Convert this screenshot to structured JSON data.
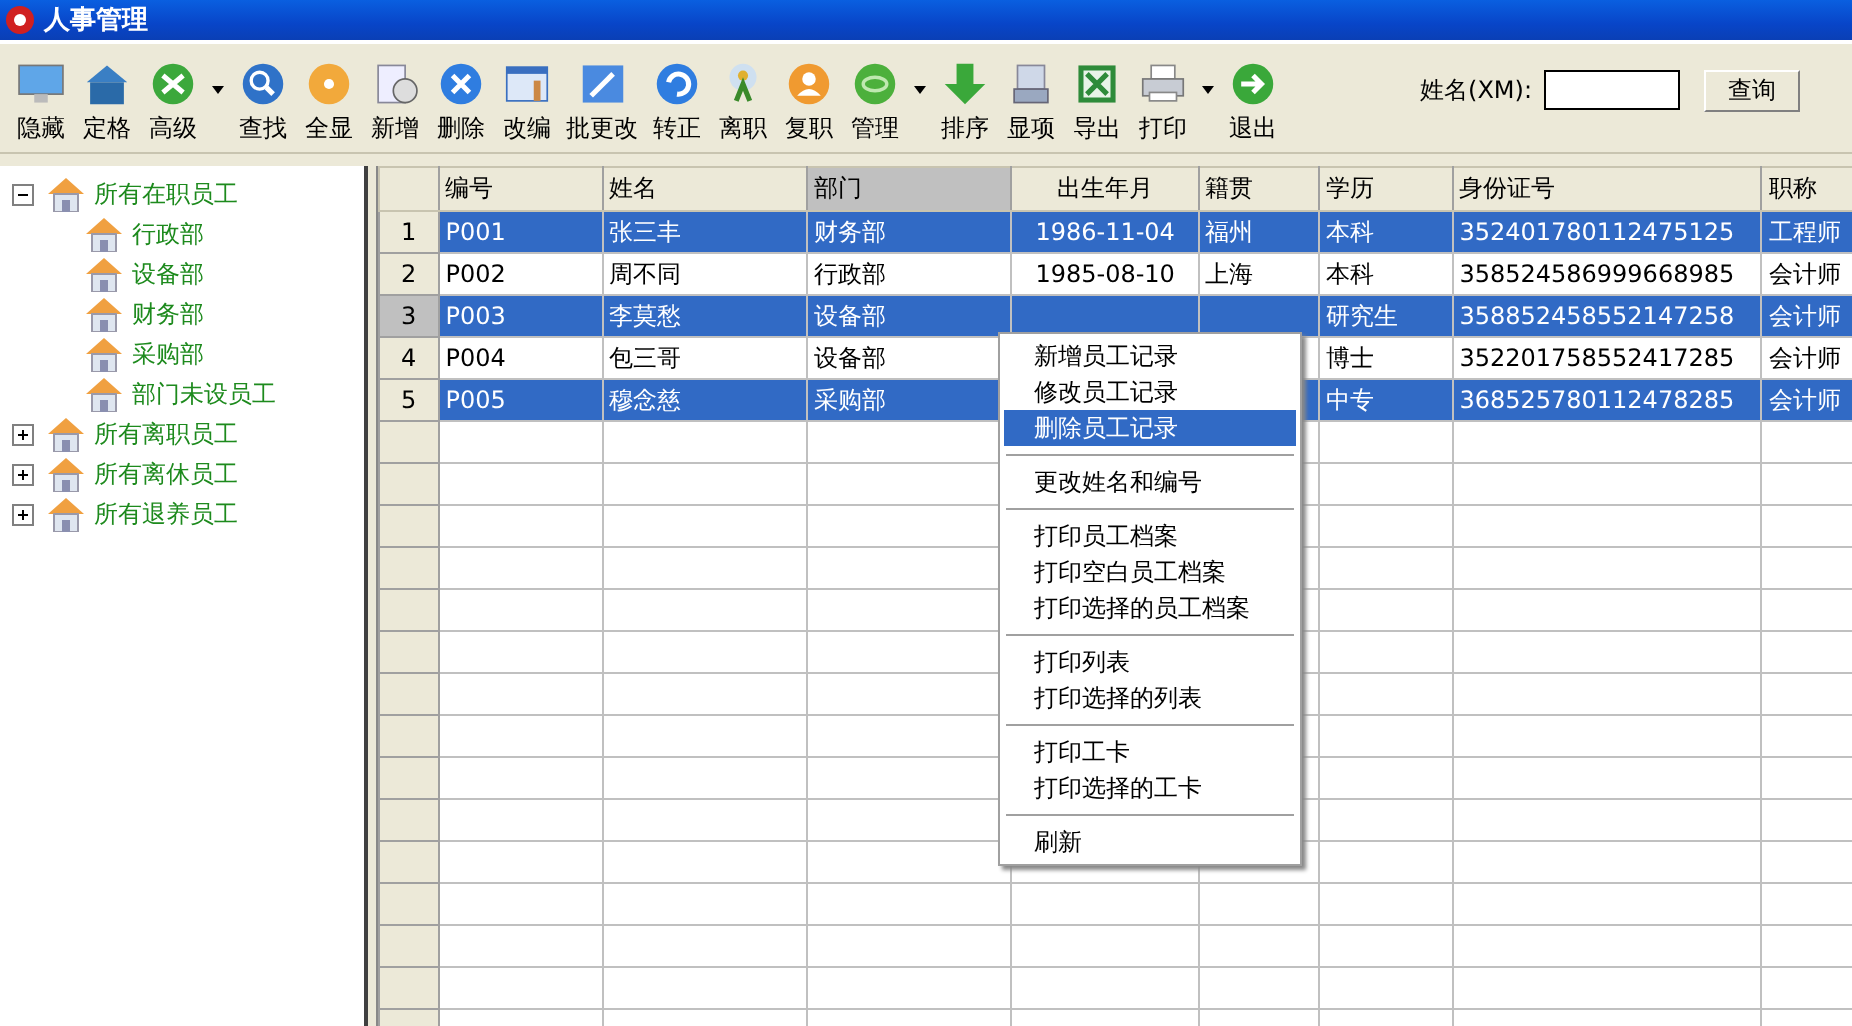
{
  "window": {
    "title": "人事管理"
  },
  "toolbar": {
    "buttons": [
      {
        "label": "隐藏",
        "dropdown": false
      },
      {
        "label": "定格",
        "dropdown": false
      },
      {
        "label": "高级",
        "dropdown": true
      },
      {
        "label": "查找",
        "dropdown": false
      },
      {
        "label": "全显",
        "dropdown": false
      },
      {
        "label": "新增",
        "dropdown": false
      },
      {
        "label": "删除",
        "dropdown": false
      },
      {
        "label": "改编",
        "dropdown": false
      },
      {
        "label": "批更改",
        "dropdown": false
      },
      {
        "label": "转正",
        "dropdown": false
      },
      {
        "label": "离职",
        "dropdown": false
      },
      {
        "label": "复职",
        "dropdown": false
      },
      {
        "label": "管理",
        "dropdown": true
      },
      {
        "label": "排序",
        "dropdown": false
      },
      {
        "label": "显项",
        "dropdown": false
      },
      {
        "label": "导出",
        "dropdown": false
      },
      {
        "label": "打印",
        "dropdown": true
      },
      {
        "label": "退出",
        "dropdown": false
      }
    ],
    "search": {
      "label": "姓名(XM):",
      "button": "查询"
    }
  },
  "tree": [
    {
      "label": "所有在职员工",
      "expanded": true,
      "children": [
        {
          "label": "行政部"
        },
        {
          "label": "设备部"
        },
        {
          "label": "财务部"
        },
        {
          "label": "采购部"
        },
        {
          "label": "部门未设员工"
        }
      ]
    },
    {
      "label": "所有离职员工",
      "expanded": false
    },
    {
      "label": "所有离休员工",
      "expanded": false
    },
    {
      "label": "所有退养员工",
      "expanded": false
    }
  ],
  "table": {
    "columns": [
      {
        "label": "编号",
        "selected": false
      },
      {
        "label": "姓名",
        "selected": false
      },
      {
        "label": "部门",
        "selected": true
      },
      {
        "label": "出生年月",
        "selected": false
      },
      {
        "label": "籍贯",
        "selected": false
      },
      {
        "label": "学历",
        "selected": false
      },
      {
        "label": "身份证号",
        "selected": false
      },
      {
        "label": "职称",
        "selected": false
      }
    ],
    "rows": [
      {
        "number": "1",
        "selected": true,
        "current": false,
        "cells": [
          "P001",
          "张三丰",
          "财务部",
          "1986-11-04",
          "福州",
          "本科",
          "352401780112475125",
          "工程师"
        ]
      },
      {
        "number": "2",
        "selected": false,
        "current": false,
        "cells": [
          "P002",
          "周不同",
          "行政部",
          "1985-08-10",
          "上海",
          "本科",
          "358524586999668985",
          "会计师"
        ]
      },
      {
        "number": "3",
        "selected": true,
        "current": true,
        "cells": [
          "P003",
          "李莫愁",
          "设备部",
          "",
          "",
          "研究生",
          "358852458552147258",
          "会计师"
        ]
      },
      {
        "number": "4",
        "selected": false,
        "current": false,
        "cells": [
          "P004",
          "包三哥",
          "设备部",
          "",
          "",
          "博士",
          "352201758552417285",
          "会计师"
        ]
      },
      {
        "number": "5",
        "selected": true,
        "current": false,
        "cells": [
          "P005",
          "穆念慈",
          "采购部",
          "",
          "",
          "中专",
          "368525780112478285",
          "会计师"
        ]
      }
    ]
  },
  "context_menu": [
    {
      "kind": "item",
      "label": "新增员工记录",
      "selected": false
    },
    {
      "kind": "item",
      "label": "修改员工记录",
      "selected": false
    },
    {
      "kind": "item",
      "label": "删除员工记录",
      "selected": true
    },
    {
      "kind": "separator"
    },
    {
      "kind": "item",
      "label": "更改姓名和编号",
      "selected": false
    },
    {
      "kind": "separator"
    },
    {
      "kind": "item",
      "label": "打印员工档案",
      "selected": false
    },
    {
      "kind": "item",
      "label": "打印空白员工档案",
      "selected": false
    },
    {
      "kind": "item",
      "label": "打印选择的员工档案",
      "selected": false
    },
    {
      "kind": "separator"
    },
    {
      "kind": "item",
      "label": "打印列表",
      "selected": false
    },
    {
      "kind": "item",
      "label": "打印选择的列表",
      "selected": false
    },
    {
      "kind": "separator"
    },
    {
      "kind": "item",
      "label": "打印工卡",
      "selected": false
    },
    {
      "kind": "item",
      "label": "打印选择的工卡",
      "selected": false
    },
    {
      "kind": "separator"
    },
    {
      "kind": "item",
      "label": "刷新",
      "selected": false
    }
  ]
}
